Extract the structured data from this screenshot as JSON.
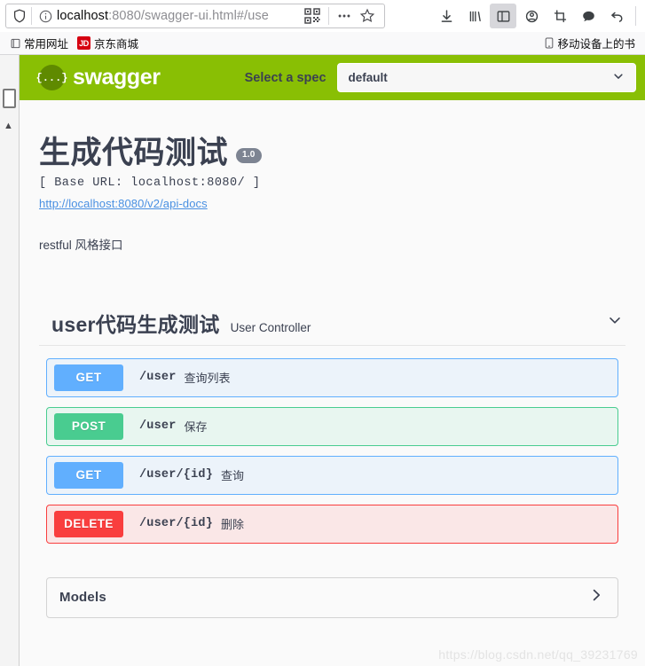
{
  "browser": {
    "url_main": "localhost",
    "url_rest": ":8080/swagger-ui.html#/use",
    "icons": {
      "shield": "shield-icon",
      "info": "info-icon",
      "qr": "qr-code-icon",
      "dots": "page-actions-icon",
      "star": "bookmark-star-icon",
      "download": "download-icon",
      "library": "library-icon",
      "sidebar": "sidebar-toggle-icon",
      "account": "account-icon",
      "screenshot": "screenshot-icon",
      "chat": "chat-bubble-icon",
      "undo": "undo-arrow-icon"
    },
    "bookmarks": [
      {
        "label": "常用网址",
        "icon": "folder-icon"
      },
      {
        "label": "京东商城",
        "icon": "jd-badge"
      }
    ],
    "bookmarks_right": {
      "label": "移动设备上的书",
      "icon": "mobile-device-icon"
    }
  },
  "topbar": {
    "logo_glyph": "{...}",
    "logo_text": "swagger",
    "spec_label": "Select a spec",
    "spec_value": "default",
    "bg_color": "#89bf04"
  },
  "info": {
    "title": "生成代码测试",
    "version": "1.0",
    "base_url": "[ Base URL: localhost:8080/ ]",
    "docs_link": "http://localhost:8080/v2/api-docs",
    "description": "restful 风格接口"
  },
  "tag": {
    "name": "user代码生成测试",
    "description": "User Controller"
  },
  "operations": [
    {
      "method": "GET",
      "path": "/user",
      "summary": "查询列表",
      "style": "op-get",
      "color": "#61affe"
    },
    {
      "method": "POST",
      "path": "/user",
      "summary": "保存",
      "style": "op-post",
      "color": "#49cc90"
    },
    {
      "method": "GET",
      "path": "/user/{id}",
      "summary": "查询",
      "style": "op-get",
      "color": "#61affe"
    },
    {
      "method": "DELETE",
      "path": "/user/{id}",
      "summary": "删除",
      "style": "op-delete",
      "color": "#f93e3e"
    }
  ],
  "models": {
    "title": "Models"
  },
  "watermark": "https://blog.csdn.net/qq_39231769"
}
